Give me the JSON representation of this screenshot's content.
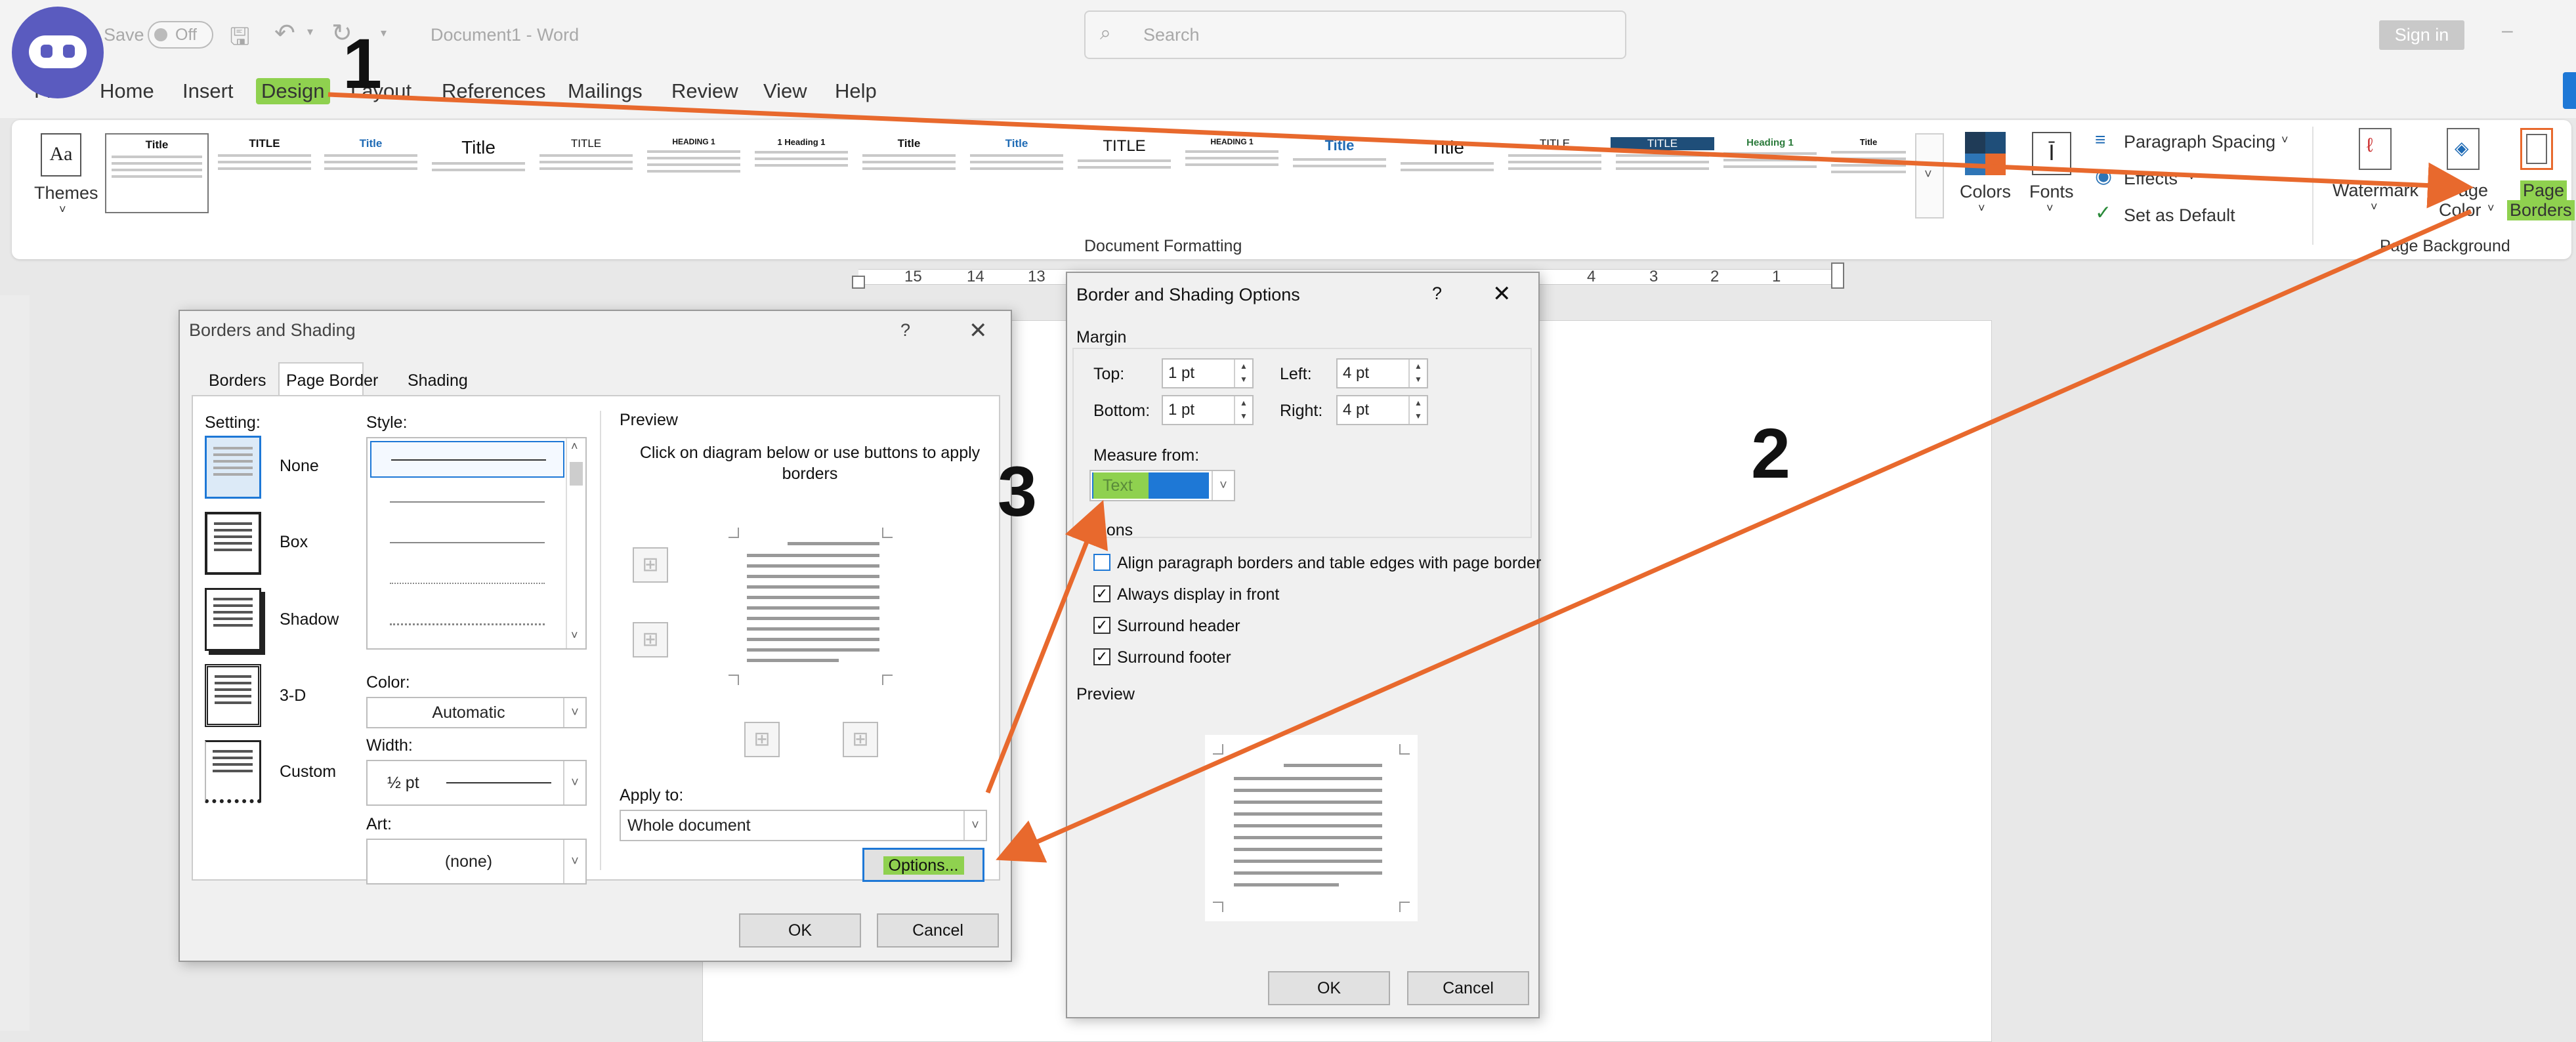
{
  "titlebar": {
    "autosave_label": "Save",
    "autosave_state": "Off",
    "doc_title": "Document1 - Word",
    "search_placeholder": "Search",
    "signin_label": "Sign in"
  },
  "menu_tabs": [
    "File",
    "Home",
    "Insert",
    "Design",
    "Layout",
    "References",
    "Mailings",
    "Review",
    "View",
    "Help"
  ],
  "ribbon": {
    "themes_label": "Themes",
    "gallery_titles": [
      "Title",
      "TITLE",
      "Title",
      "Title",
      "TITLE",
      "HEADING 1",
      "1 Heading 1",
      "Title",
      "Title",
      "TITLE",
      "HEADING 1",
      "Title",
      "Title",
      "TITLE",
      "TITLE",
      "Heading 1",
      "Title"
    ],
    "document_formatting_label": "Document Formatting",
    "colors_label": "Colors",
    "fonts_label": "Fonts",
    "paragraph_spacing_label": "Paragraph Spacing",
    "effects_label": "Effects",
    "set_default_label": "Set as Default",
    "watermark_label": "Watermark",
    "page_color_label1": "Page",
    "page_color_label2": "Color",
    "page_borders_label1": "Page",
    "page_borders_label2": "Borders",
    "page_background_label": "Page Background"
  },
  "ruler_numbers": [
    "15",
    "14",
    "13",
    "4",
    "3",
    "2",
    "1"
  ],
  "borders_dialog": {
    "title": "Borders and Shading",
    "help": "?",
    "tabs": [
      "Borders",
      "Page Border",
      "Shading"
    ],
    "setting_label": "Setting:",
    "settings": [
      "None",
      "Box",
      "Shadow",
      "3-D",
      "Custom"
    ],
    "style_label": "Style:",
    "color_label": "Color:",
    "color_value": "Automatic",
    "width_label": "Width:",
    "width_value": "½ pt",
    "art_label": "Art:",
    "art_value": "(none)",
    "preview_label": "Preview",
    "preview_hint": "Click on diagram below or use buttons to apply borders",
    "apply_label": "Apply to:",
    "apply_value": "Whole document",
    "options_label": "Options...",
    "ok_label": "OK",
    "cancel_label": "Cancel"
  },
  "options_dialog": {
    "title": "Border and Shading Options",
    "help": "?",
    "margin_label": "Margin",
    "top_label": "Top:",
    "top_value": "1 pt",
    "bottom_label": "Bottom:",
    "bottom_value": "1 pt",
    "left_label": "Left:",
    "left_value": "4 pt",
    "right_label": "Right:",
    "right_value": "4 pt",
    "measure_label": "Measure from:",
    "measure_value": "Text",
    "options_label": "Options",
    "checks": [
      {
        "label": "Align paragraph borders and table edges with page border",
        "checked": false
      },
      {
        "label": "Always display in front",
        "checked": true
      },
      {
        "label": "Surround header",
        "checked": true
      },
      {
        "label": "Surround footer",
        "checked": true
      }
    ],
    "preview_label": "Preview",
    "ok_label": "OK",
    "cancel_label": "Cancel"
  },
  "annotations": [
    "1",
    "2",
    "3"
  ],
  "colors": {
    "highlight": "#8fd14f",
    "arrow": "#e8692d",
    "selected_blue": "#1e78d6"
  }
}
